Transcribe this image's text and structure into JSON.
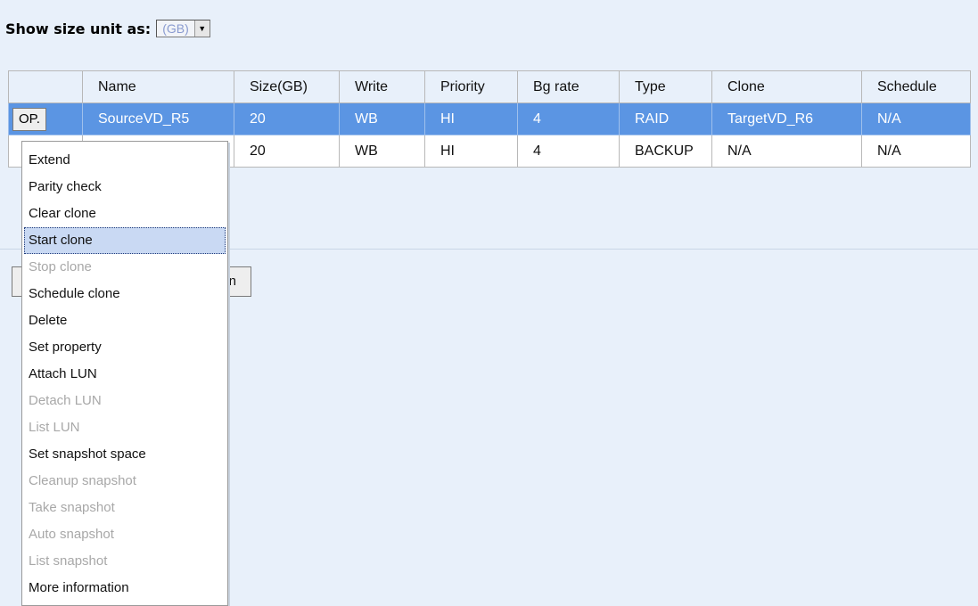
{
  "unit_selector": {
    "label": "Show size unit as:",
    "value": "(GB)"
  },
  "table": {
    "columns": [
      "",
      "Name",
      "Size(GB)",
      "Write",
      "Priority",
      "Bg rate",
      "Type",
      "Clone",
      "Schedule"
    ],
    "rows": [
      {
        "op_label": "OP.",
        "name": "SourceVD_R5",
        "size": "20",
        "write": "WB",
        "priority": "HI",
        "bg_rate": "4",
        "type": "RAID",
        "clone": "TargetVD_R6",
        "schedule": "N/A",
        "selected": true
      },
      {
        "op_label": "",
        "name": "",
        "size": "20",
        "write": "WB",
        "priority": "HI",
        "bg_rate": "4",
        "type": "BACKUP",
        "clone": "N/A",
        "schedule": "N/A",
        "selected": false
      }
    ]
  },
  "background_button": {
    "label_fragment": "on"
  },
  "context_menu": {
    "items": [
      {
        "label": "Extend",
        "enabled": true
      },
      {
        "label": "Parity check",
        "enabled": true
      },
      {
        "label": "Clear clone",
        "enabled": true
      },
      {
        "label": "Start clone",
        "enabled": true,
        "active": true
      },
      {
        "label": "Stop clone",
        "enabled": false
      },
      {
        "label": "Schedule clone",
        "enabled": true
      },
      {
        "label": "Delete",
        "enabled": true
      },
      {
        "label": "Set property",
        "enabled": true
      },
      {
        "label": "Attach LUN",
        "enabled": true
      },
      {
        "label": "Detach LUN",
        "enabled": false
      },
      {
        "label": "List LUN",
        "enabled": false
      },
      {
        "label": "Set snapshot space",
        "enabled": true
      },
      {
        "label": "Cleanup snapshot",
        "enabled": false
      },
      {
        "label": "Take snapshot",
        "enabled": false
      },
      {
        "label": "Auto snapshot",
        "enabled": false
      },
      {
        "label": "List snapshot",
        "enabled": false
      },
      {
        "label": "More information",
        "enabled": true
      }
    ]
  },
  "colors": {
    "page_background": "#e8f0fa",
    "selected_row": "#5b95e3",
    "menu_highlight": "#c9d9f3",
    "disabled_text": "#a8a8a8"
  }
}
